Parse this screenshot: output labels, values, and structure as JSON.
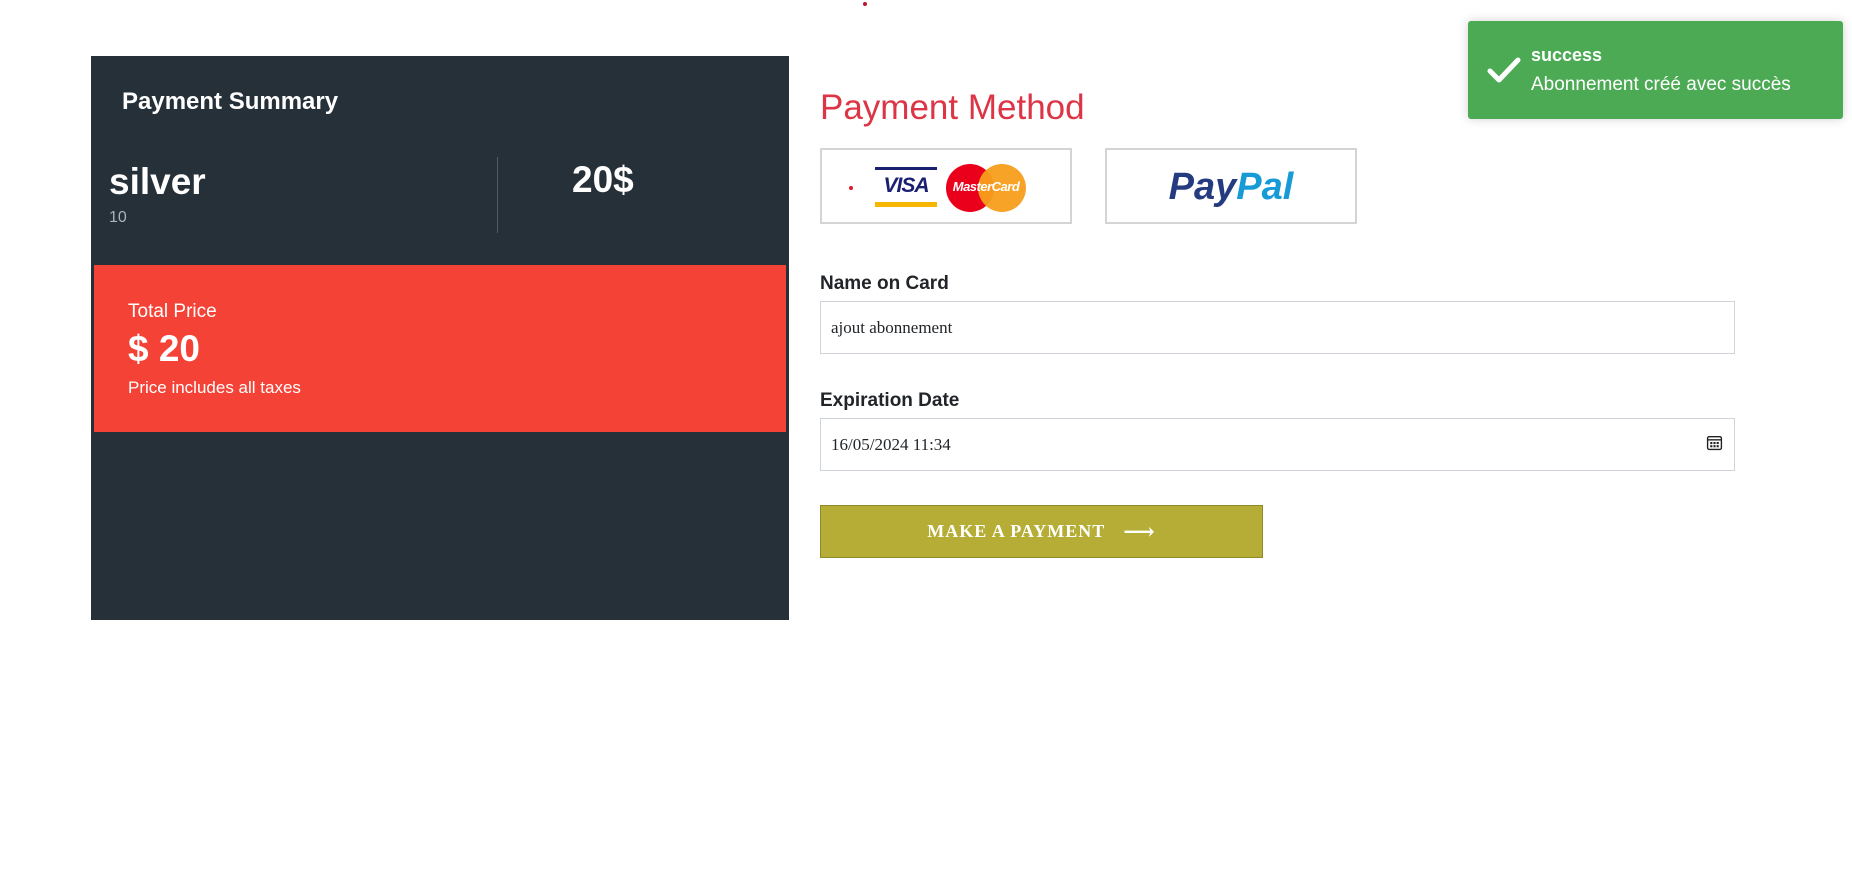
{
  "summary": {
    "title": "Payment Summary",
    "plan_name": "silver",
    "plan_sub": "10",
    "plan_price": "20$",
    "total_label": "Total Price",
    "total_value": "$ 20",
    "total_note": "Price includes all taxes"
  },
  "payment_method": {
    "title": "Payment Method",
    "options": [
      {
        "id": "cards",
        "brands": [
          "VISA",
          "MasterCard"
        ],
        "selected": true
      },
      {
        "id": "paypal",
        "brand_part1": "Pay",
        "brand_part2": "Pal"
      }
    ]
  },
  "form": {
    "name_label": "Name on Card",
    "name_value": "ajout abonnement",
    "expiration_label": "Expiration Date",
    "expiration_value": "16/05/2024 11:34",
    "submit_label": "MAKE A PAYMENT",
    "submit_icon": "arrow-right-icon"
  },
  "toast": {
    "title": "success",
    "message": "Abonnement créé avec succès",
    "icon": "check-icon"
  },
  "colors": {
    "panel_bg": "#263038",
    "total_bg": "#f44336",
    "accent_red": "#dc3545",
    "button_bg": "#b5ad35",
    "toast_bg": "#4caa55"
  }
}
